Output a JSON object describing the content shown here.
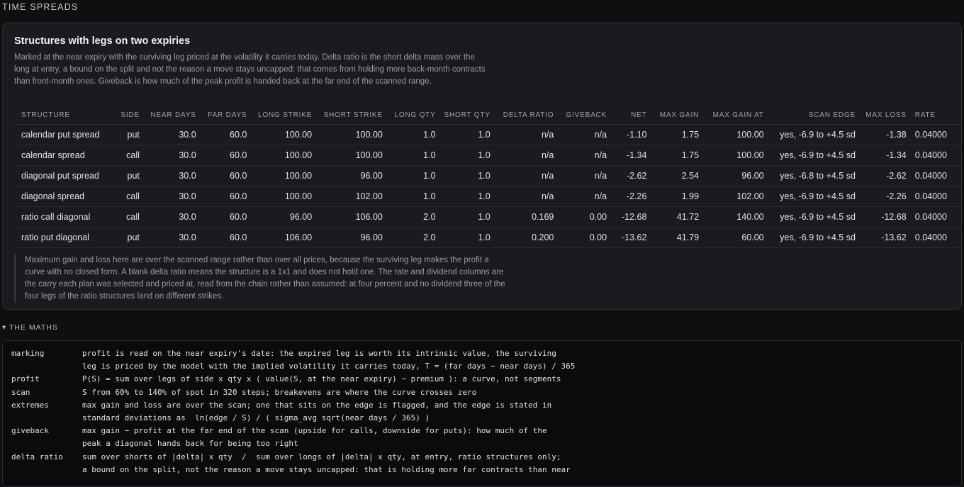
{
  "section_title": "TIME SPREADS",
  "card": {
    "title": "Structures with legs on two expiries",
    "description": "Marked at the near expiry with the surviving leg priced at the volatility it carries today. Delta ratio is the short delta mass over the long at entry, a bound on the split and not the reason a move stays uncapped: that comes from holding more back-month contracts than front-month ones. Giveback is how much of the peak profit is handed back at the far end of the scanned range.",
    "note": "Maximum gain and loss here are over the scanned range rather than over all prices, because the surviving leg makes the profit a curve with no closed form. A blank delta ratio means the structure is a 1x1 and does not hold one. The rate and dividend columns are the carry each plan was selected and priced at, read from the chain rather than assumed: at four percent and no dividend three of the four legs of the ratio structures land on different strikes."
  },
  "table": {
    "headers": [
      "STRUCTURE",
      "SIDE",
      "NEAR DAYS",
      "FAR DAYS",
      "LONG STRIKE",
      "SHORT STRIKE",
      "LONG QTY",
      "SHORT QTY",
      "DELTA RATIO",
      "GIVEBACK",
      "NET",
      "MAX GAIN",
      "MAX GAIN AT",
      "SCAN EDGE",
      "MAX LOSS",
      "RATE"
    ],
    "rows": [
      [
        "calendar put spread",
        "put",
        "30.0",
        "60.0",
        "100.00",
        "100.00",
        "1.0",
        "1.0",
        "n/a",
        "n/a",
        "-1.10",
        "1.75",
        "100.00",
        "yes, -6.9 to +4.5 sd",
        "-1.38",
        "0.04000"
      ],
      [
        "calendar spread",
        "call",
        "30.0",
        "60.0",
        "100.00",
        "100.00",
        "1.0",
        "1.0",
        "n/a",
        "n/a",
        "-1.34",
        "1.75",
        "100.00",
        "yes, -6.9 to +4.5 sd",
        "-1.34",
        "0.04000"
      ],
      [
        "diagonal put spread",
        "put",
        "30.0",
        "60.0",
        "100.00",
        "96.00",
        "1.0",
        "1.0",
        "n/a",
        "n/a",
        "-2.62",
        "2.54",
        "96.00",
        "yes, -6.8 to +4.5 sd",
        "-2.62",
        "0.04000"
      ],
      [
        "diagonal spread",
        "call",
        "30.0",
        "60.0",
        "100.00",
        "102.00",
        "1.0",
        "1.0",
        "n/a",
        "n/a",
        "-2.26",
        "1.99",
        "102.00",
        "yes, -6.9 to +4.5 sd",
        "-2.26",
        "0.04000"
      ],
      [
        "ratio call diagonal",
        "call",
        "30.0",
        "60.0",
        "96.00",
        "106.00",
        "2.0",
        "1.0",
        "0.169",
        "0.00",
        "-12.68",
        "41.72",
        "140.00",
        "yes, -6.9 to +4.5 sd",
        "-12.68",
        "0.04000"
      ],
      [
        "ratio put diagonal",
        "put",
        "30.0",
        "60.0",
        "106.00",
        "96.00",
        "2.0",
        "1.0",
        "0.200",
        "0.00",
        "-13.62",
        "41.79",
        "60.00",
        "yes, -6.9 to +4.5 sd",
        "-13.62",
        "0.04000"
      ]
    ]
  },
  "maths": {
    "toggle_label": "▾ THE MATHS",
    "entries": [
      {
        "term": "marking",
        "lines": [
          "profit is read on the near expiry's date: the expired leg is worth its intrinsic value, the surviving",
          "leg is priced by the model with the implied volatility it carries today, T = (far days − near days) / 365"
        ]
      },
      {
        "term": "profit",
        "lines": [
          "P(S) = sum over legs of side x qty x ( value(S, at the near expiry) − premium ): a curve, not segments"
        ]
      },
      {
        "term": "scan",
        "lines": [
          "S from 60% to 140% of spot in 320 steps; breakevens are where the curve crosses zero"
        ]
      },
      {
        "term": "extremes",
        "lines": [
          "max gain and loss are over the scan; one that sits on the edge is flagged, and the edge is stated in",
          "standard deviations as  ln(edge / S) / ( sigma_avg sqrt(near days / 365) )"
        ]
      },
      {
        "term": "giveback",
        "lines": [
          "max gain − profit at the far end of the scan (upside for calls, downside for puts): how much of the",
          "peak a diagonal hands back for being too right"
        ]
      },
      {
        "term": "delta ratio",
        "lines": [
          "sum over shorts of |delta| x qty  /  sum over longs of |delta| x qty, at entry, ratio structures only;",
          "a bound on the split, not the reason a move stays uncapped: that is holding more far contracts than near"
        ]
      }
    ]
  }
}
